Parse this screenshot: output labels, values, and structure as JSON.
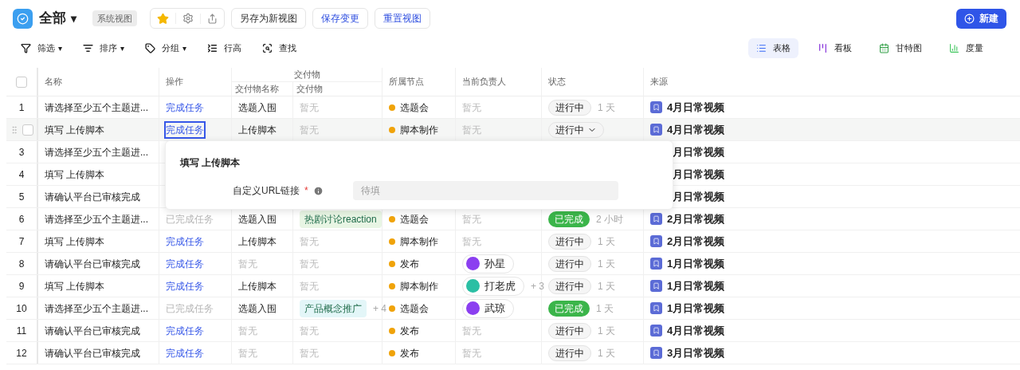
{
  "header": {
    "title": "全部",
    "title_caret": "▾",
    "view_badge": "系统视图",
    "starred": true,
    "buttons": [
      {
        "label": "另存为新视图",
        "primary": false
      },
      {
        "label": "保存变更",
        "primary": true
      },
      {
        "label": "重置视图",
        "primary": true
      }
    ],
    "new_button": "新建"
  },
  "toolbar": {
    "tools": [
      {
        "kind": "filter",
        "label": "筛选",
        "caret": "▾"
      },
      {
        "kind": "sort",
        "label": "排序",
        "caret": "▾"
      },
      {
        "kind": "group",
        "label": "分组",
        "caret": "▾"
      },
      {
        "kind": "height",
        "label": "行高"
      },
      {
        "kind": "find",
        "label": "查找"
      }
    ],
    "views": [
      {
        "kind": "table",
        "label": "表格",
        "selected": true
      },
      {
        "kind": "kanban",
        "label": "看板",
        "selected": false
      },
      {
        "kind": "gantt",
        "label": "甘特图",
        "selected": false
      },
      {
        "kind": "metric",
        "label": "度量",
        "selected": false
      }
    ]
  },
  "table": {
    "select_all_checked": false,
    "columns": {
      "name": "名称",
      "action": "操作",
      "deliverable_group": "交付物",
      "deliverable_name": "交付物名称",
      "deliverable": "交付物",
      "node": "所属节点",
      "owner": "当前负责人",
      "status": "状态",
      "source": "来源"
    },
    "rows": [
      {
        "index": "1",
        "hovered": false,
        "name": "请选择至少五个主题进...",
        "action": {
          "text": "完成任务",
          "done": false
        },
        "deliverable_name": {
          "text": "选题入围",
          "empty": false
        },
        "deliverable": {
          "kind": "empty",
          "text": "暂无"
        },
        "node": "选题会",
        "owner": {
          "kind": "empty",
          "text": "暂无"
        },
        "status": {
          "text": "进行中",
          "done": false,
          "dropdown": false
        },
        "duration": "1 天",
        "source": {
          "icon": true,
          "text": "4月日常视频"
        }
      },
      {
        "hovered": true,
        "checked": false,
        "name": "填写 上传脚本",
        "action": {
          "text": "完成任务",
          "done": false,
          "focused": true
        },
        "deliverable_name": {
          "text": "上传脚本",
          "empty": false
        },
        "deliverable": {
          "kind": "empty",
          "text": "暂无"
        },
        "node": "脚本制作",
        "owner": {
          "kind": "empty",
          "text": "暂无"
        },
        "status": {
          "text": "进行中",
          "done": false,
          "dropdown": true
        },
        "source": {
          "icon": true,
          "text": "4月日常视频"
        }
      },
      {
        "index": "3",
        "hovered": false,
        "name": "请选择至少五个主题进...",
        "source": {
          "text": "月日常视频"
        }
      },
      {
        "index": "4",
        "hovered": false,
        "name": "填写 上传脚本",
        "source": {
          "text": "月日常视频"
        }
      },
      {
        "index": "5",
        "hovered": false,
        "name": "请确认平台已审核完成",
        "source": {
          "text": "月日常视频"
        }
      },
      {
        "index": "6",
        "hovered": false,
        "name": "请选择至少五个主题进...",
        "action": {
          "text": "已完成任务",
          "done": true
        },
        "deliverable_name": {
          "text": "选题入围",
          "empty": false
        },
        "deliverable": {
          "kind": "tag",
          "text": "热剧讨论reaction",
          "color": "#e8f5e4"
        },
        "node": "选题会",
        "owner": {
          "kind": "empty",
          "text": "暂无"
        },
        "status": {
          "text": "已完成",
          "done": true,
          "dropdown": false
        },
        "duration": "2 小时",
        "source": {
          "icon": true,
          "text": "2月日常视频"
        }
      },
      {
        "index": "7",
        "hovered": false,
        "name": "填写 上传脚本",
        "action": {
          "text": "完成任务",
          "done": false
        },
        "deliverable_name": {
          "text": "上传脚本",
          "empty": false
        },
        "deliverable": {
          "kind": "empty",
          "text": "暂无"
        },
        "node": "脚本制作",
        "owner": {
          "kind": "empty",
          "text": "暂无"
        },
        "status": {
          "text": "进行中",
          "done": false,
          "dropdown": false
        },
        "duration": "1 天",
        "source": {
          "icon": true,
          "text": "2月日常视频"
        }
      },
      {
        "index": "8",
        "hovered": false,
        "name": "请确认平台已审核完成",
        "action": {
          "text": "完成任务",
          "done": false
        },
        "deliverable_name": {
          "text": "暂无",
          "empty": true
        },
        "deliverable": {
          "kind": "empty",
          "text": "暂无"
        },
        "node": "发布",
        "owner": {
          "kind": "person",
          "text": "孙星",
          "color": "#8b3ff0"
        },
        "status": {
          "text": "进行中",
          "done": false,
          "dropdown": false
        },
        "duration": "1 天",
        "source": {
          "icon": true,
          "text": "1月日常视频"
        }
      },
      {
        "index": "9",
        "hovered": false,
        "name": "填写 上传脚本",
        "action": {
          "text": "完成任务",
          "done": false
        },
        "deliverable_name": {
          "text": "上传脚本",
          "empty": false
        },
        "deliverable": {
          "kind": "empty",
          "text": "暂无"
        },
        "node": "脚本制作",
        "owner": {
          "kind": "person",
          "text": "打老虎",
          "color": "#2bbfa4",
          "more": "+ 3"
        },
        "status": {
          "text": "进行中",
          "done": false,
          "dropdown": false
        },
        "duration": "1 天",
        "source": {
          "icon": true,
          "text": "1月日常视频"
        }
      },
      {
        "index": "10",
        "hovered": false,
        "name": "请选择至少五个主题进...",
        "action": {
          "text": "已完成任务",
          "done": true
        },
        "deliverable_name": {
          "text": "选题入围",
          "empty": false
        },
        "deliverable": {
          "kind": "tag",
          "text": "产品概念推广",
          "color": "#e3f6f8",
          "more": "+ 4"
        },
        "node": "选题会",
        "owner": {
          "kind": "person",
          "text": "武琼",
          "color": "#8b3ff0"
        },
        "status": {
          "text": "已完成",
          "done": true,
          "dropdown": false
        },
        "duration": "1 天",
        "source": {
          "icon": true,
          "text": "1月日常视频"
        }
      },
      {
        "index": "11",
        "hovered": false,
        "name": "请确认平台已审核完成",
        "action": {
          "text": "完成任务",
          "done": false
        },
        "deliverable_name": {
          "text": "暂无",
          "empty": true
        },
        "deliverable": {
          "kind": "empty",
          "text": "暂无"
        },
        "node": "发布",
        "owner": {
          "kind": "empty",
          "text": "暂无"
        },
        "status": {
          "text": "进行中",
          "done": false,
          "dropdown": false
        },
        "duration": "1 天",
        "source": {
          "icon": true,
          "text": "4月日常视频"
        }
      },
      {
        "index": "12",
        "hovered": false,
        "name": "请确认平台已审核完成",
        "action": {
          "text": "完成任务",
          "done": false
        },
        "deliverable_name": {
          "text": "暂无",
          "empty": true
        },
        "deliverable": {
          "kind": "empty",
          "text": "暂无"
        },
        "node": "发布",
        "owner": {
          "kind": "empty",
          "text": "暂无"
        },
        "status": {
          "text": "进行中",
          "done": false,
          "dropdown": false
        },
        "duration": "1 天",
        "source": {
          "icon": true,
          "text": "3月日常视频"
        }
      }
    ]
  },
  "popup": {
    "title": "填写 上传脚本",
    "field_label": "自定义URL链接",
    "required": "*",
    "placeholder": "待填"
  }
}
